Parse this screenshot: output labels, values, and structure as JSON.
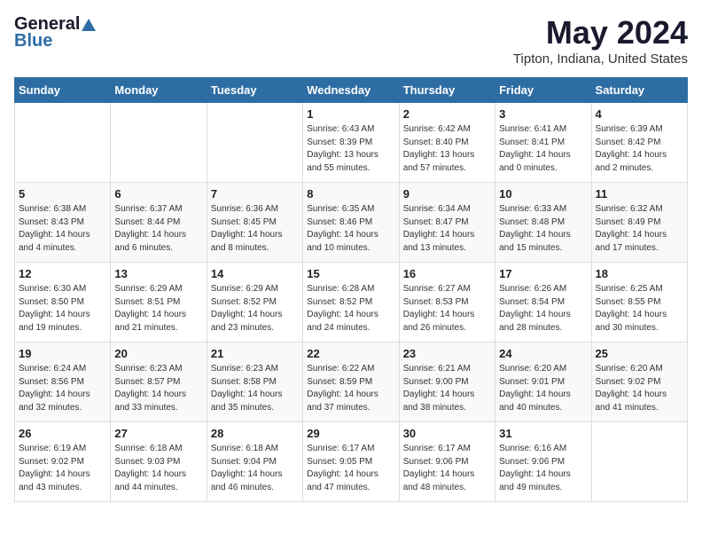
{
  "header": {
    "logo_general": "General",
    "logo_blue": "Blue",
    "month_title": "May 2024",
    "location": "Tipton, Indiana, United States"
  },
  "weekdays": [
    "Sunday",
    "Monday",
    "Tuesday",
    "Wednesday",
    "Thursday",
    "Friday",
    "Saturday"
  ],
  "weeks": [
    [
      {
        "day": "",
        "info": ""
      },
      {
        "day": "",
        "info": ""
      },
      {
        "day": "",
        "info": ""
      },
      {
        "day": "1",
        "info": "Sunrise: 6:43 AM\nSunset: 8:39 PM\nDaylight: 13 hours\nand 55 minutes."
      },
      {
        "day": "2",
        "info": "Sunrise: 6:42 AM\nSunset: 8:40 PM\nDaylight: 13 hours\nand 57 minutes."
      },
      {
        "day": "3",
        "info": "Sunrise: 6:41 AM\nSunset: 8:41 PM\nDaylight: 14 hours\nand 0 minutes."
      },
      {
        "day": "4",
        "info": "Sunrise: 6:39 AM\nSunset: 8:42 PM\nDaylight: 14 hours\nand 2 minutes."
      }
    ],
    [
      {
        "day": "5",
        "info": "Sunrise: 6:38 AM\nSunset: 8:43 PM\nDaylight: 14 hours\nand 4 minutes."
      },
      {
        "day": "6",
        "info": "Sunrise: 6:37 AM\nSunset: 8:44 PM\nDaylight: 14 hours\nand 6 minutes."
      },
      {
        "day": "7",
        "info": "Sunrise: 6:36 AM\nSunset: 8:45 PM\nDaylight: 14 hours\nand 8 minutes."
      },
      {
        "day": "8",
        "info": "Sunrise: 6:35 AM\nSunset: 8:46 PM\nDaylight: 14 hours\nand 10 minutes."
      },
      {
        "day": "9",
        "info": "Sunrise: 6:34 AM\nSunset: 8:47 PM\nDaylight: 14 hours\nand 13 minutes."
      },
      {
        "day": "10",
        "info": "Sunrise: 6:33 AM\nSunset: 8:48 PM\nDaylight: 14 hours\nand 15 minutes."
      },
      {
        "day": "11",
        "info": "Sunrise: 6:32 AM\nSunset: 8:49 PM\nDaylight: 14 hours\nand 17 minutes."
      }
    ],
    [
      {
        "day": "12",
        "info": "Sunrise: 6:30 AM\nSunset: 8:50 PM\nDaylight: 14 hours\nand 19 minutes."
      },
      {
        "day": "13",
        "info": "Sunrise: 6:29 AM\nSunset: 8:51 PM\nDaylight: 14 hours\nand 21 minutes."
      },
      {
        "day": "14",
        "info": "Sunrise: 6:29 AM\nSunset: 8:52 PM\nDaylight: 14 hours\nand 23 minutes."
      },
      {
        "day": "15",
        "info": "Sunrise: 6:28 AM\nSunset: 8:52 PM\nDaylight: 14 hours\nand 24 minutes."
      },
      {
        "day": "16",
        "info": "Sunrise: 6:27 AM\nSunset: 8:53 PM\nDaylight: 14 hours\nand 26 minutes."
      },
      {
        "day": "17",
        "info": "Sunrise: 6:26 AM\nSunset: 8:54 PM\nDaylight: 14 hours\nand 28 minutes."
      },
      {
        "day": "18",
        "info": "Sunrise: 6:25 AM\nSunset: 8:55 PM\nDaylight: 14 hours\nand 30 minutes."
      }
    ],
    [
      {
        "day": "19",
        "info": "Sunrise: 6:24 AM\nSunset: 8:56 PM\nDaylight: 14 hours\nand 32 minutes."
      },
      {
        "day": "20",
        "info": "Sunrise: 6:23 AM\nSunset: 8:57 PM\nDaylight: 14 hours\nand 33 minutes."
      },
      {
        "day": "21",
        "info": "Sunrise: 6:23 AM\nSunset: 8:58 PM\nDaylight: 14 hours\nand 35 minutes."
      },
      {
        "day": "22",
        "info": "Sunrise: 6:22 AM\nSunset: 8:59 PM\nDaylight: 14 hours\nand 37 minutes."
      },
      {
        "day": "23",
        "info": "Sunrise: 6:21 AM\nSunset: 9:00 PM\nDaylight: 14 hours\nand 38 minutes."
      },
      {
        "day": "24",
        "info": "Sunrise: 6:20 AM\nSunset: 9:01 PM\nDaylight: 14 hours\nand 40 minutes."
      },
      {
        "day": "25",
        "info": "Sunrise: 6:20 AM\nSunset: 9:02 PM\nDaylight: 14 hours\nand 41 minutes."
      }
    ],
    [
      {
        "day": "26",
        "info": "Sunrise: 6:19 AM\nSunset: 9:02 PM\nDaylight: 14 hours\nand 43 minutes."
      },
      {
        "day": "27",
        "info": "Sunrise: 6:18 AM\nSunset: 9:03 PM\nDaylight: 14 hours\nand 44 minutes."
      },
      {
        "day": "28",
        "info": "Sunrise: 6:18 AM\nSunset: 9:04 PM\nDaylight: 14 hours\nand 46 minutes."
      },
      {
        "day": "29",
        "info": "Sunrise: 6:17 AM\nSunset: 9:05 PM\nDaylight: 14 hours\nand 47 minutes."
      },
      {
        "day": "30",
        "info": "Sunrise: 6:17 AM\nSunset: 9:06 PM\nDaylight: 14 hours\nand 48 minutes."
      },
      {
        "day": "31",
        "info": "Sunrise: 6:16 AM\nSunset: 9:06 PM\nDaylight: 14 hours\nand 49 minutes."
      },
      {
        "day": "",
        "info": ""
      }
    ]
  ]
}
